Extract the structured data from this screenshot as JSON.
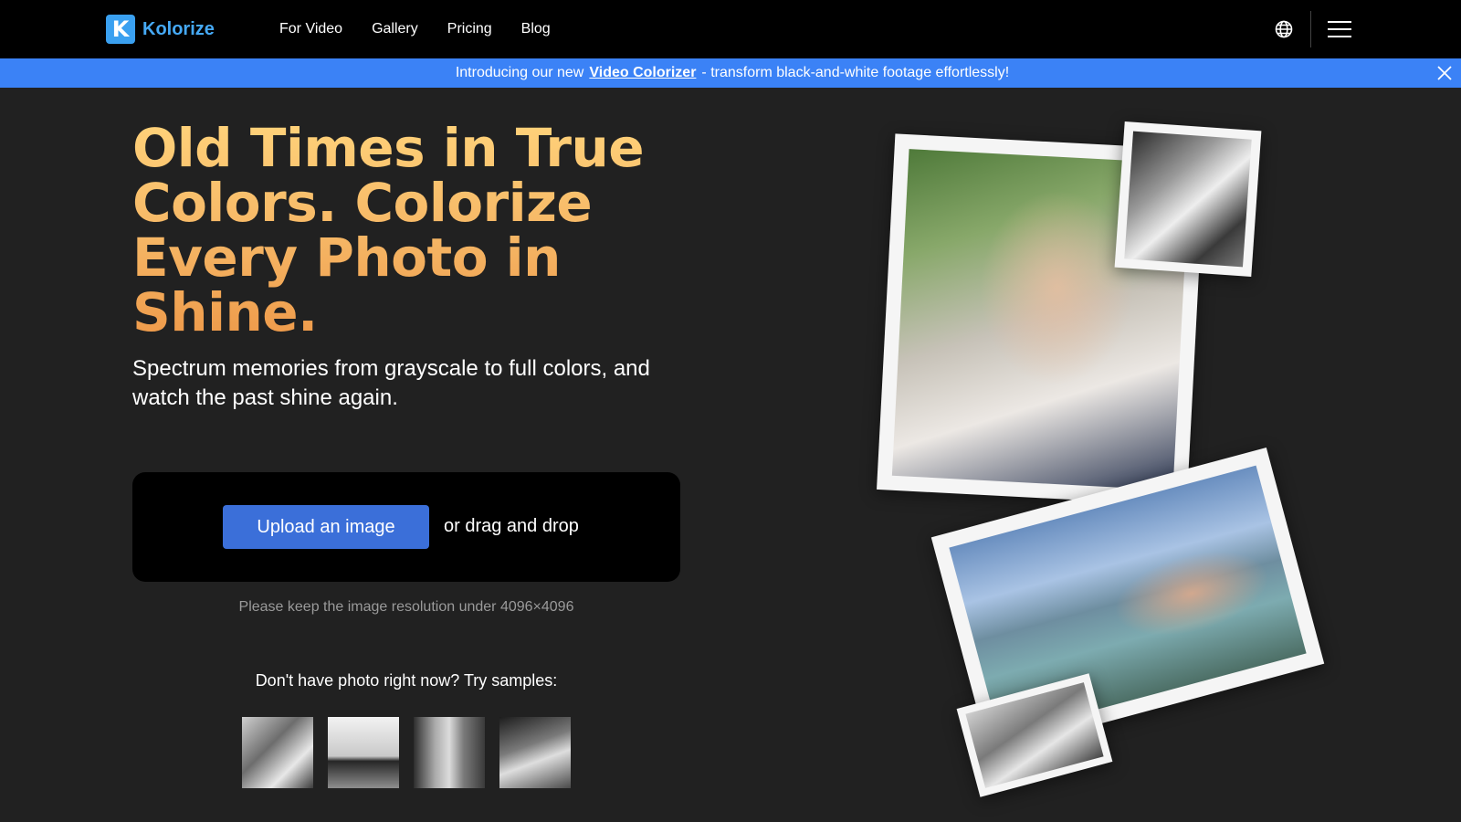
{
  "nav": {
    "logo_mark": "K",
    "logo_text": "Kolorize",
    "links": [
      "For Video",
      "Gallery",
      "Pricing",
      "Blog"
    ],
    "globe_icon": "globe-icon",
    "menu_icon": "hamburger-menu-icon"
  },
  "banner": {
    "prefix_glyph": "",
    "text_before": "Introducing our new",
    "link_text": "Video Colorizer",
    "text_after": "- transform black-and-white footage effortlessly!",
    "close_icon": "close-icon"
  },
  "hero": {
    "title": "Old Times in True Colors. Colorize Every Photo in Shine.",
    "subtitle": "Spectrum memories from grayscale to full colors, and watch the past shine again."
  },
  "upload": {
    "button_label": "Upload an image",
    "drag_text": "or drag and drop",
    "resolution_note": "Please keep the image resolution under 4096×4096"
  },
  "samples": {
    "title": "Don't have photo right now? Try samples:"
  },
  "colors": {
    "nav_bg": "#000000",
    "page_bg": "#212121",
    "banner_bg": "#3b82f6",
    "brand": "#45a9f5",
    "upload_button": "#3b6fd9",
    "title_gradient_top": "#ffd27a",
    "title_gradient_bottom": "#ee9a4a"
  }
}
